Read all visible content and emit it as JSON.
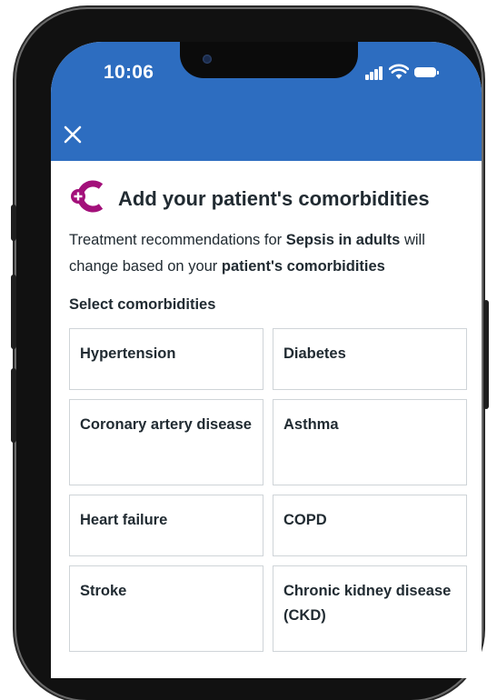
{
  "status_bar": {
    "time": "10:06"
  },
  "header": {
    "close_icon": "close-icon",
    "color": "#2d6dc0"
  },
  "title": "Add your patient's comorbidities",
  "description": {
    "part1": "Treatment recommendations for ",
    "condition": "Sepsis in adults",
    "part2": " will change based on your ",
    "emphasis": "patient's comorbidities"
  },
  "select_label": "Select comorbidities",
  "comorbidities": [
    "Hypertension",
    "Diabetes",
    "Coronary artery disease",
    "Asthma",
    "Heart failure",
    "COPD",
    "Stroke",
    "Chronic kidney disease (CKD)"
  ],
  "colors": {
    "brand_magenta": "#a3107a",
    "text": "#212b32",
    "card_border": "#cfd4d8"
  }
}
